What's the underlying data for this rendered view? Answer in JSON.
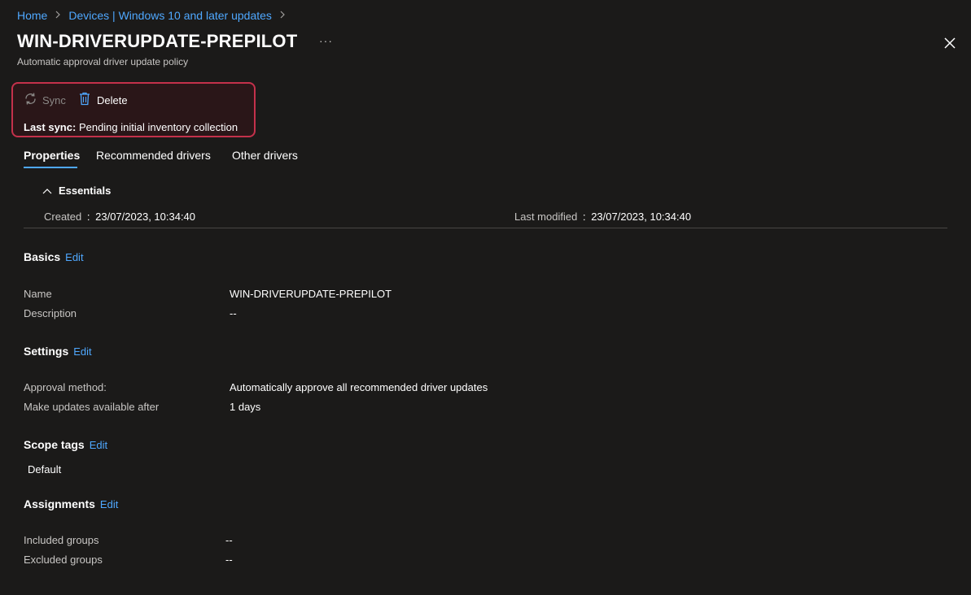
{
  "breadcrumb": {
    "home": "Home",
    "devices": "Devices | Windows 10 and later updates"
  },
  "page": {
    "title": "WIN-DRIVERUPDATE-PREPILOT",
    "more": "···",
    "subtitle": "Automatic approval driver update policy"
  },
  "toolbar": {
    "sync_label": "Sync",
    "delete_label": "Delete",
    "last_sync_label": "Last sync:",
    "last_sync_value": "Pending initial inventory collection",
    "highlight_color": "#c4314b"
  },
  "tabs": [
    {
      "label": "Properties",
      "active": true
    },
    {
      "label": "Recommended drivers",
      "active": false
    },
    {
      "label": "Other drivers",
      "active": false
    }
  ],
  "essentials": {
    "title": "Essentials",
    "created_label": "Created",
    "created_value": "23/07/2023, 10:34:40",
    "modified_label": "Last modified",
    "modified_value": "23/07/2023, 10:34:40",
    "separator": ":"
  },
  "basics": {
    "title": "Basics",
    "edit": "Edit",
    "name_label": "Name",
    "name_value": "WIN-DRIVERUPDATE-PREPILOT",
    "description_label": "Description",
    "description_value": "--"
  },
  "settings": {
    "title": "Settings",
    "edit": "Edit",
    "approval_label": "Approval method:",
    "approval_value": "Automatically approve all recommended driver updates",
    "available_label": "Make updates available after",
    "available_value": "1 days"
  },
  "scope_tags": {
    "title": "Scope tags",
    "edit": "Edit",
    "value": "Default"
  },
  "assignments": {
    "title": "Assignments",
    "edit": "Edit",
    "included_label": "Included groups",
    "included_value": "--",
    "excluded_label": "Excluded groups",
    "excluded_value": "--"
  },
  "colors": {
    "background": "#1b1a19",
    "accent": "#4fa8ff"
  }
}
